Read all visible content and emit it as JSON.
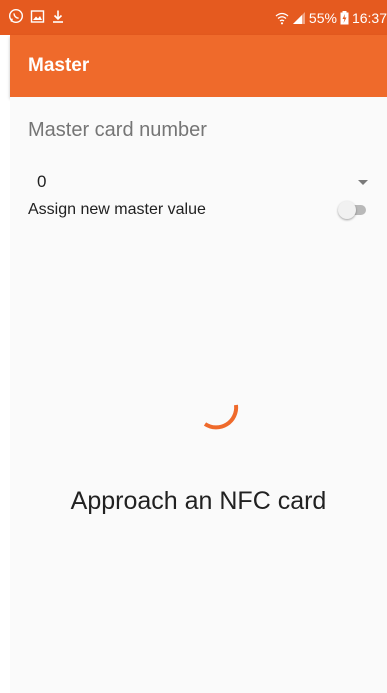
{
  "status_bar": {
    "left_icons": [
      "whatsapp-icon",
      "image-icon",
      "download-icon"
    ],
    "battery_percent": "55%",
    "time": "16:37",
    "accent": "#e55a1f"
  },
  "app_bar": {
    "title": "Master",
    "color": "#ef6a2b"
  },
  "form": {
    "section_label": "Master card number",
    "selected_value": "0",
    "toggle_label": "Assign new master value",
    "toggle_on": false
  },
  "progress": {
    "icon": "spinner-icon",
    "color": "#ef6a2b"
  },
  "message": "Approach an NFC card"
}
